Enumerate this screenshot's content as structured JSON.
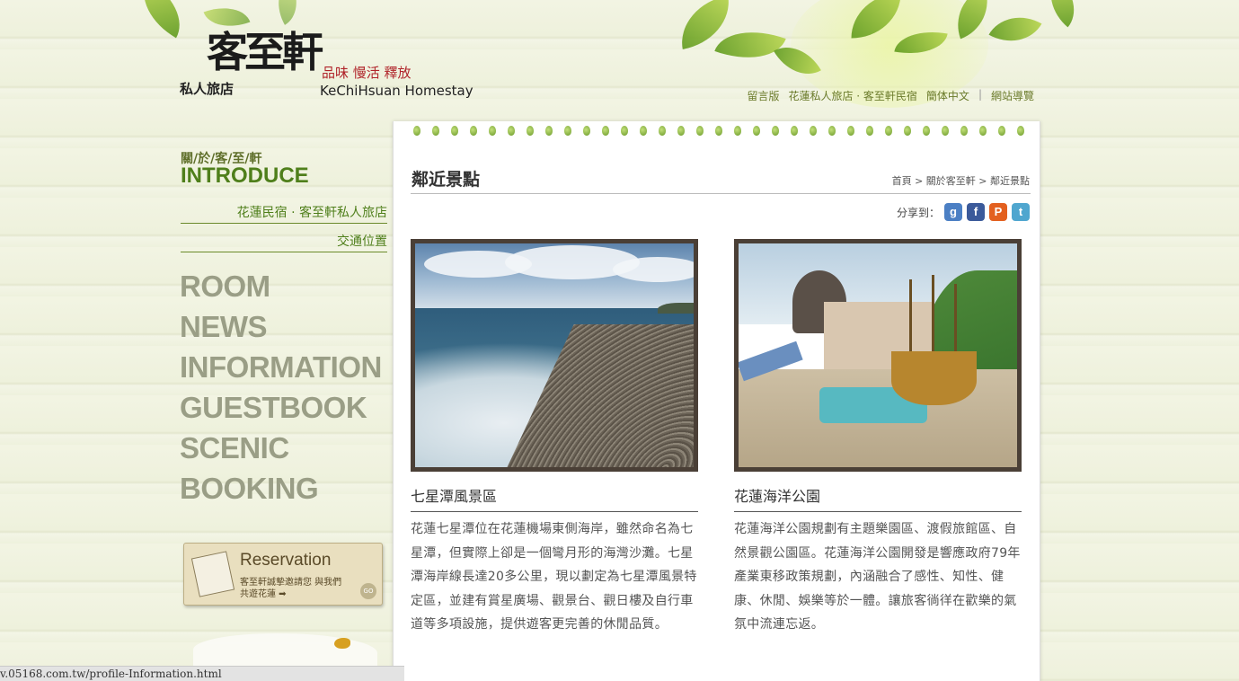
{
  "brand": {
    "name_big": "客至軒",
    "name_small": "私人旅店",
    "slogan": "品味 慢活 釋放",
    "name_en": "KeChiHsuan Homestay"
  },
  "top_nav": {
    "mobile": "留言版",
    "site_name": "花蓮私人旅店 · 客至軒民宿",
    "lang": "簡体中文",
    "sep": "|",
    "sitemap": "網站導覽"
  },
  "left_menu": {
    "section_cn": "關/於/客/至/軒",
    "section_en": "INTRODUCE",
    "sub_links": [
      "花蓮民宿 · 客至軒私人旅店",
      "交通位置"
    ],
    "main_items": [
      "ROOM",
      "NEWS",
      "INFORMATION",
      "GUESTBOOK",
      "SCENIC",
      "BOOKING"
    ]
  },
  "reservation": {
    "title": "Reservation",
    "line1": "客至軒誠摯邀請您 與我們",
    "line2": "共遊花蓮 ➡",
    "go": "GO"
  },
  "content": {
    "title": "鄰近景點",
    "breadcrumb": "首頁 > 關於客至軒 > 鄰近景點",
    "share_label": "分享到：",
    "share_icons": [
      {
        "name": "google-share-icon",
        "glyph": "g",
        "color": "#4b7fc4"
      },
      {
        "name": "facebook-share-icon",
        "glyph": "f",
        "color": "#3b5a9a"
      },
      {
        "name": "plurk-share-icon",
        "glyph": "P",
        "color": "#e3601f"
      },
      {
        "name": "twitter-share-icon",
        "glyph": "t",
        "color": "#4fa6cf"
      }
    ],
    "spots": [
      {
        "title": "七星潭風景區",
        "text": "花蓮七星潭位在花蓮機場東側海岸，雖然命名為七星潭，但實際上卻是一個彎月形的海灣沙灘。七星潭海岸線長達20多公里，現以劃定為七星潭風景特定區，並建有賞星廣場、觀景台、觀日樓及自行車道等多項設施，提供遊客更完善的休閒品質。"
      },
      {
        "title": "花蓮海洋公園",
        "text": "花蓮海洋公園規劃有主題樂園區、渡假旅館區、自然景觀公園區。花蓮海洋公園開發是響應政府79年產業東移政策規劃，內涵融合了感性、知性、健康、休閒、娛樂等於一體。讓旅客徜徉在歡樂的氣氛中流連忘返。"
      }
    ]
  },
  "status_bar": "v.05168.com.tw/profile-Information.html"
}
